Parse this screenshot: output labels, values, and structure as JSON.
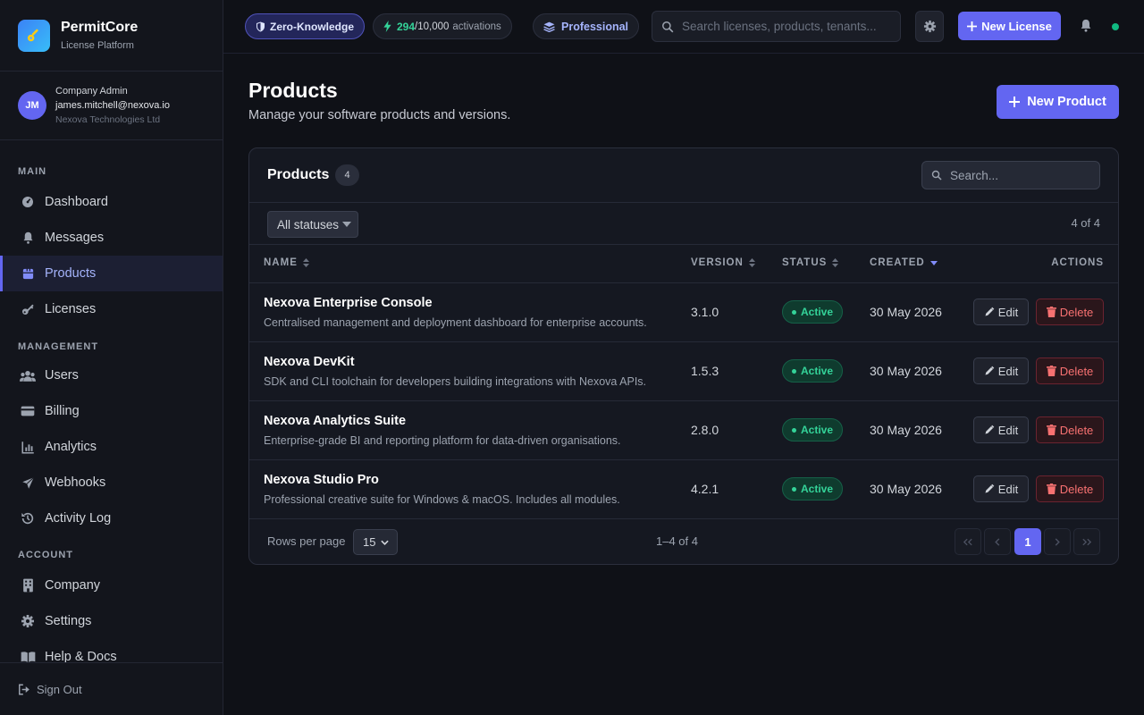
{
  "brand": {
    "name": "PermitCore",
    "subtitle": "License Platform"
  },
  "user": {
    "initials": "JM",
    "role": "Company Admin",
    "email": "james.mitchell@nexova.io",
    "company": "Nexova Technologies Ltd"
  },
  "nav": {
    "sections": [
      {
        "title": "MAIN",
        "items": [
          {
            "label": "Dashboard",
            "icon": "dashboard-icon"
          },
          {
            "label": "Messages",
            "icon": "bell-icon"
          },
          {
            "label": "Products",
            "icon": "box-icon",
            "active": true
          },
          {
            "label": "Licenses",
            "icon": "key-icon"
          }
        ]
      },
      {
        "title": "MANAGEMENT",
        "items": [
          {
            "label": "Users",
            "icon": "users-icon"
          },
          {
            "label": "Billing",
            "icon": "credit-card-icon"
          },
          {
            "label": "Analytics",
            "icon": "chart-icon"
          },
          {
            "label": "Webhooks",
            "icon": "send-icon"
          },
          {
            "label": "Activity Log",
            "icon": "history-icon"
          }
        ]
      },
      {
        "title": "ACCOUNT",
        "items": [
          {
            "label": "Company",
            "icon": "building-icon"
          },
          {
            "label": "Settings",
            "icon": "gear-icon"
          },
          {
            "label": "Help & Docs",
            "icon": "book-icon"
          }
        ]
      }
    ],
    "signout": "Sign Out"
  },
  "topbar": {
    "zk_label": "Zero-Knowledge",
    "activations_used": "294",
    "activations_total": "/10,000",
    "activations_label": "activations",
    "plan": "Professional",
    "search_placeholder": "Search licenses, products, tenants...",
    "new_license": "New License",
    "colors": {
      "accent": "#6366f1",
      "online": "#10b981"
    }
  },
  "page": {
    "title": "Products",
    "subtitle": "Manage your software products and versions.",
    "new_button": "New Product"
  },
  "card": {
    "title": "Products",
    "count": "4",
    "search_placeholder": "Search...",
    "filter": "All statuses",
    "filter_count": "4 of 4",
    "columns": {
      "name": "NAME",
      "version": "VERSION",
      "status": "STATUS",
      "created": "CREATED",
      "actions": "ACTIONS"
    },
    "rows": [
      {
        "name": "Nexova Enterprise Console",
        "description": "Centralised management and deployment dashboard for enterprise accounts.",
        "version": "3.1.0",
        "status": "Active",
        "created": "30 May 2026"
      },
      {
        "name": "Nexova DevKit",
        "description": "SDK and CLI toolchain for developers building integrations with Nexova APIs.",
        "version": "1.5.3",
        "status": "Active",
        "created": "30 May 2026"
      },
      {
        "name": "Nexova Analytics Suite",
        "description": "Enterprise-grade BI and reporting platform for data-driven organisations.",
        "version": "2.8.0",
        "status": "Active",
        "created": "30 May 2026"
      },
      {
        "name": "Nexova Studio Pro",
        "description": "Professional creative suite for Windows & macOS. Includes all modules.",
        "version": "4.2.1",
        "status": "Active",
        "created": "30 May 2026"
      }
    ],
    "edit_label": "Edit",
    "delete_label": "Delete",
    "footer": {
      "rows_per_page_label": "Rows per page",
      "rows_per_page": "15",
      "range": "1–4 of 4",
      "current_page": "1"
    }
  }
}
